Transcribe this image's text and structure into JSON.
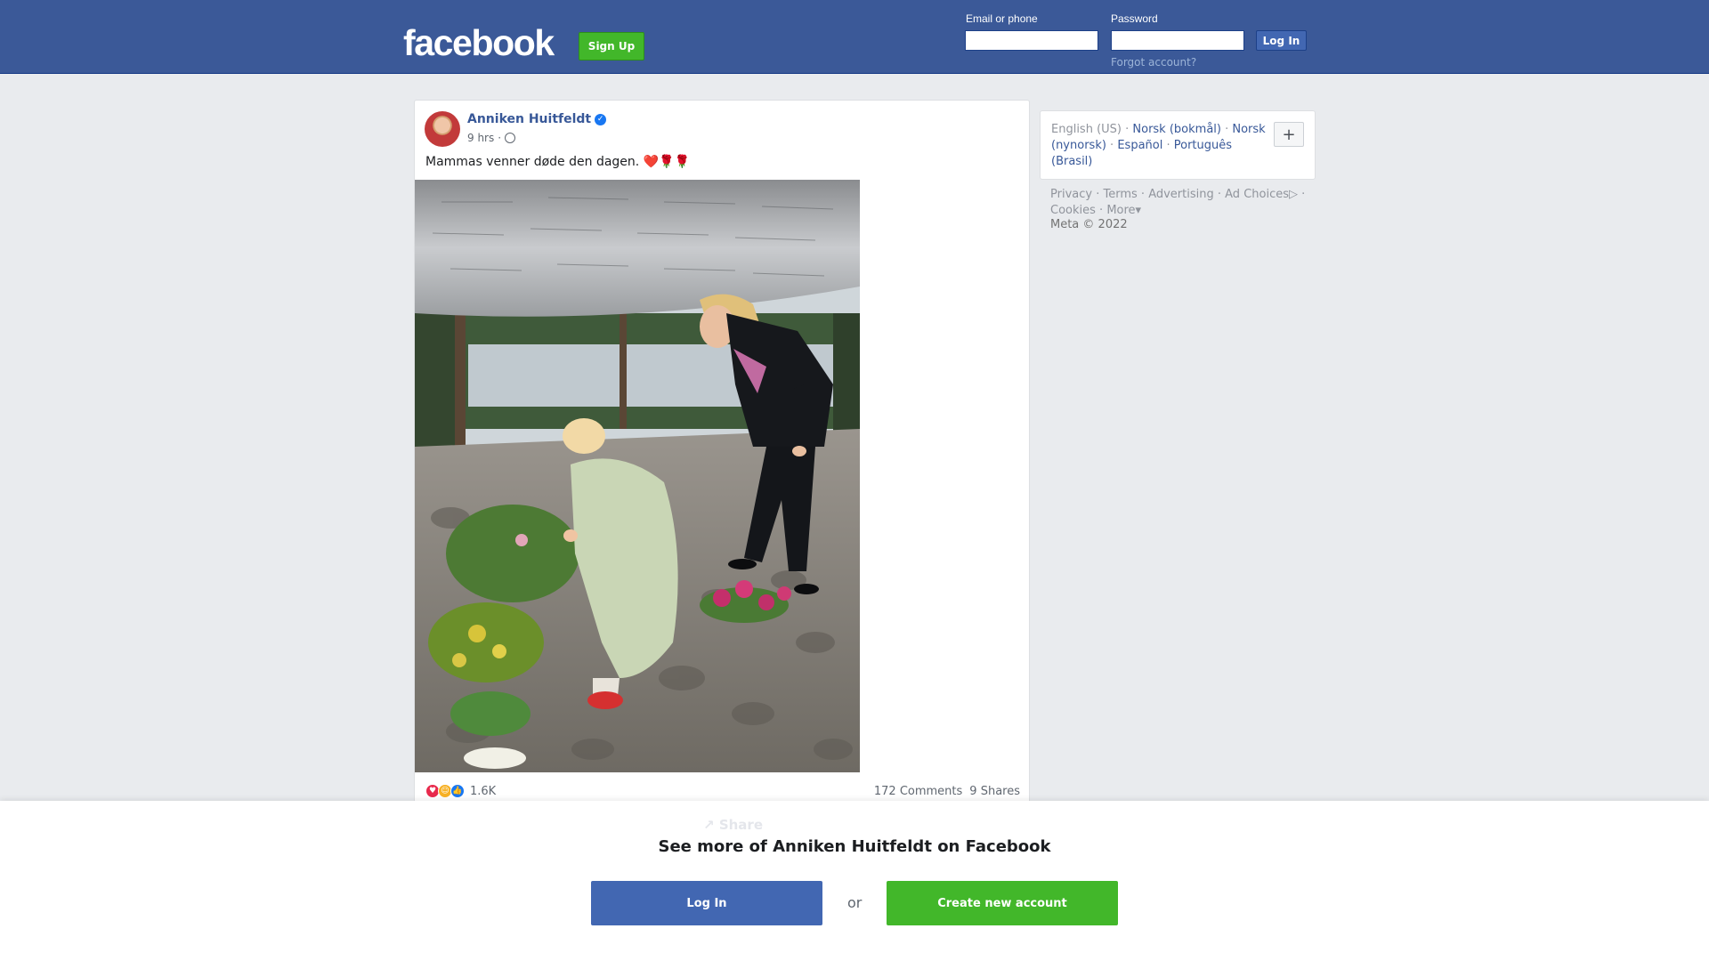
{
  "header": {
    "logo": "facebook",
    "signup_label": "Sign Up",
    "email_label": "Email or phone",
    "password_label": "Password",
    "login_label": "Log In",
    "forgot_label": "Forgot account?"
  },
  "post": {
    "author": "Anniken Huitfeldt",
    "time": "9 hrs",
    "separator": "·",
    "text": "Mammas venner døde den dagen. ❤️🌹🌹",
    "reaction_count": "1.6K",
    "comments": "172 Comments",
    "shares": "9 Shares",
    "share_label": "Share"
  },
  "sidebar": {
    "current_language": "English (US)",
    "languages": [
      "Norsk (bokmål)",
      "Norsk (nynorsk)",
      "Español",
      "Português (Brasil)"
    ],
    "plus": "+",
    "footer_links": [
      "Privacy",
      "Terms",
      "Advertising",
      "Ad Choices",
      "Cookies",
      "More"
    ],
    "copyright": "Meta © 2022"
  },
  "overlay": {
    "title": "See more of Anniken Huitfeldt on Facebook",
    "login_label": "Log In",
    "or": "or",
    "create_label": "Create new account"
  },
  "icons": {
    "verified": "verified-badge-icon",
    "globe": "globe-icon",
    "reactions": [
      "love-reaction-icon",
      "care-reaction-icon",
      "like-reaction-icon"
    ]
  },
  "colors": {
    "brand": "#3b5998",
    "button_green": "#42b72a",
    "link": "#385898",
    "login_blue": "#4267b2"
  }
}
